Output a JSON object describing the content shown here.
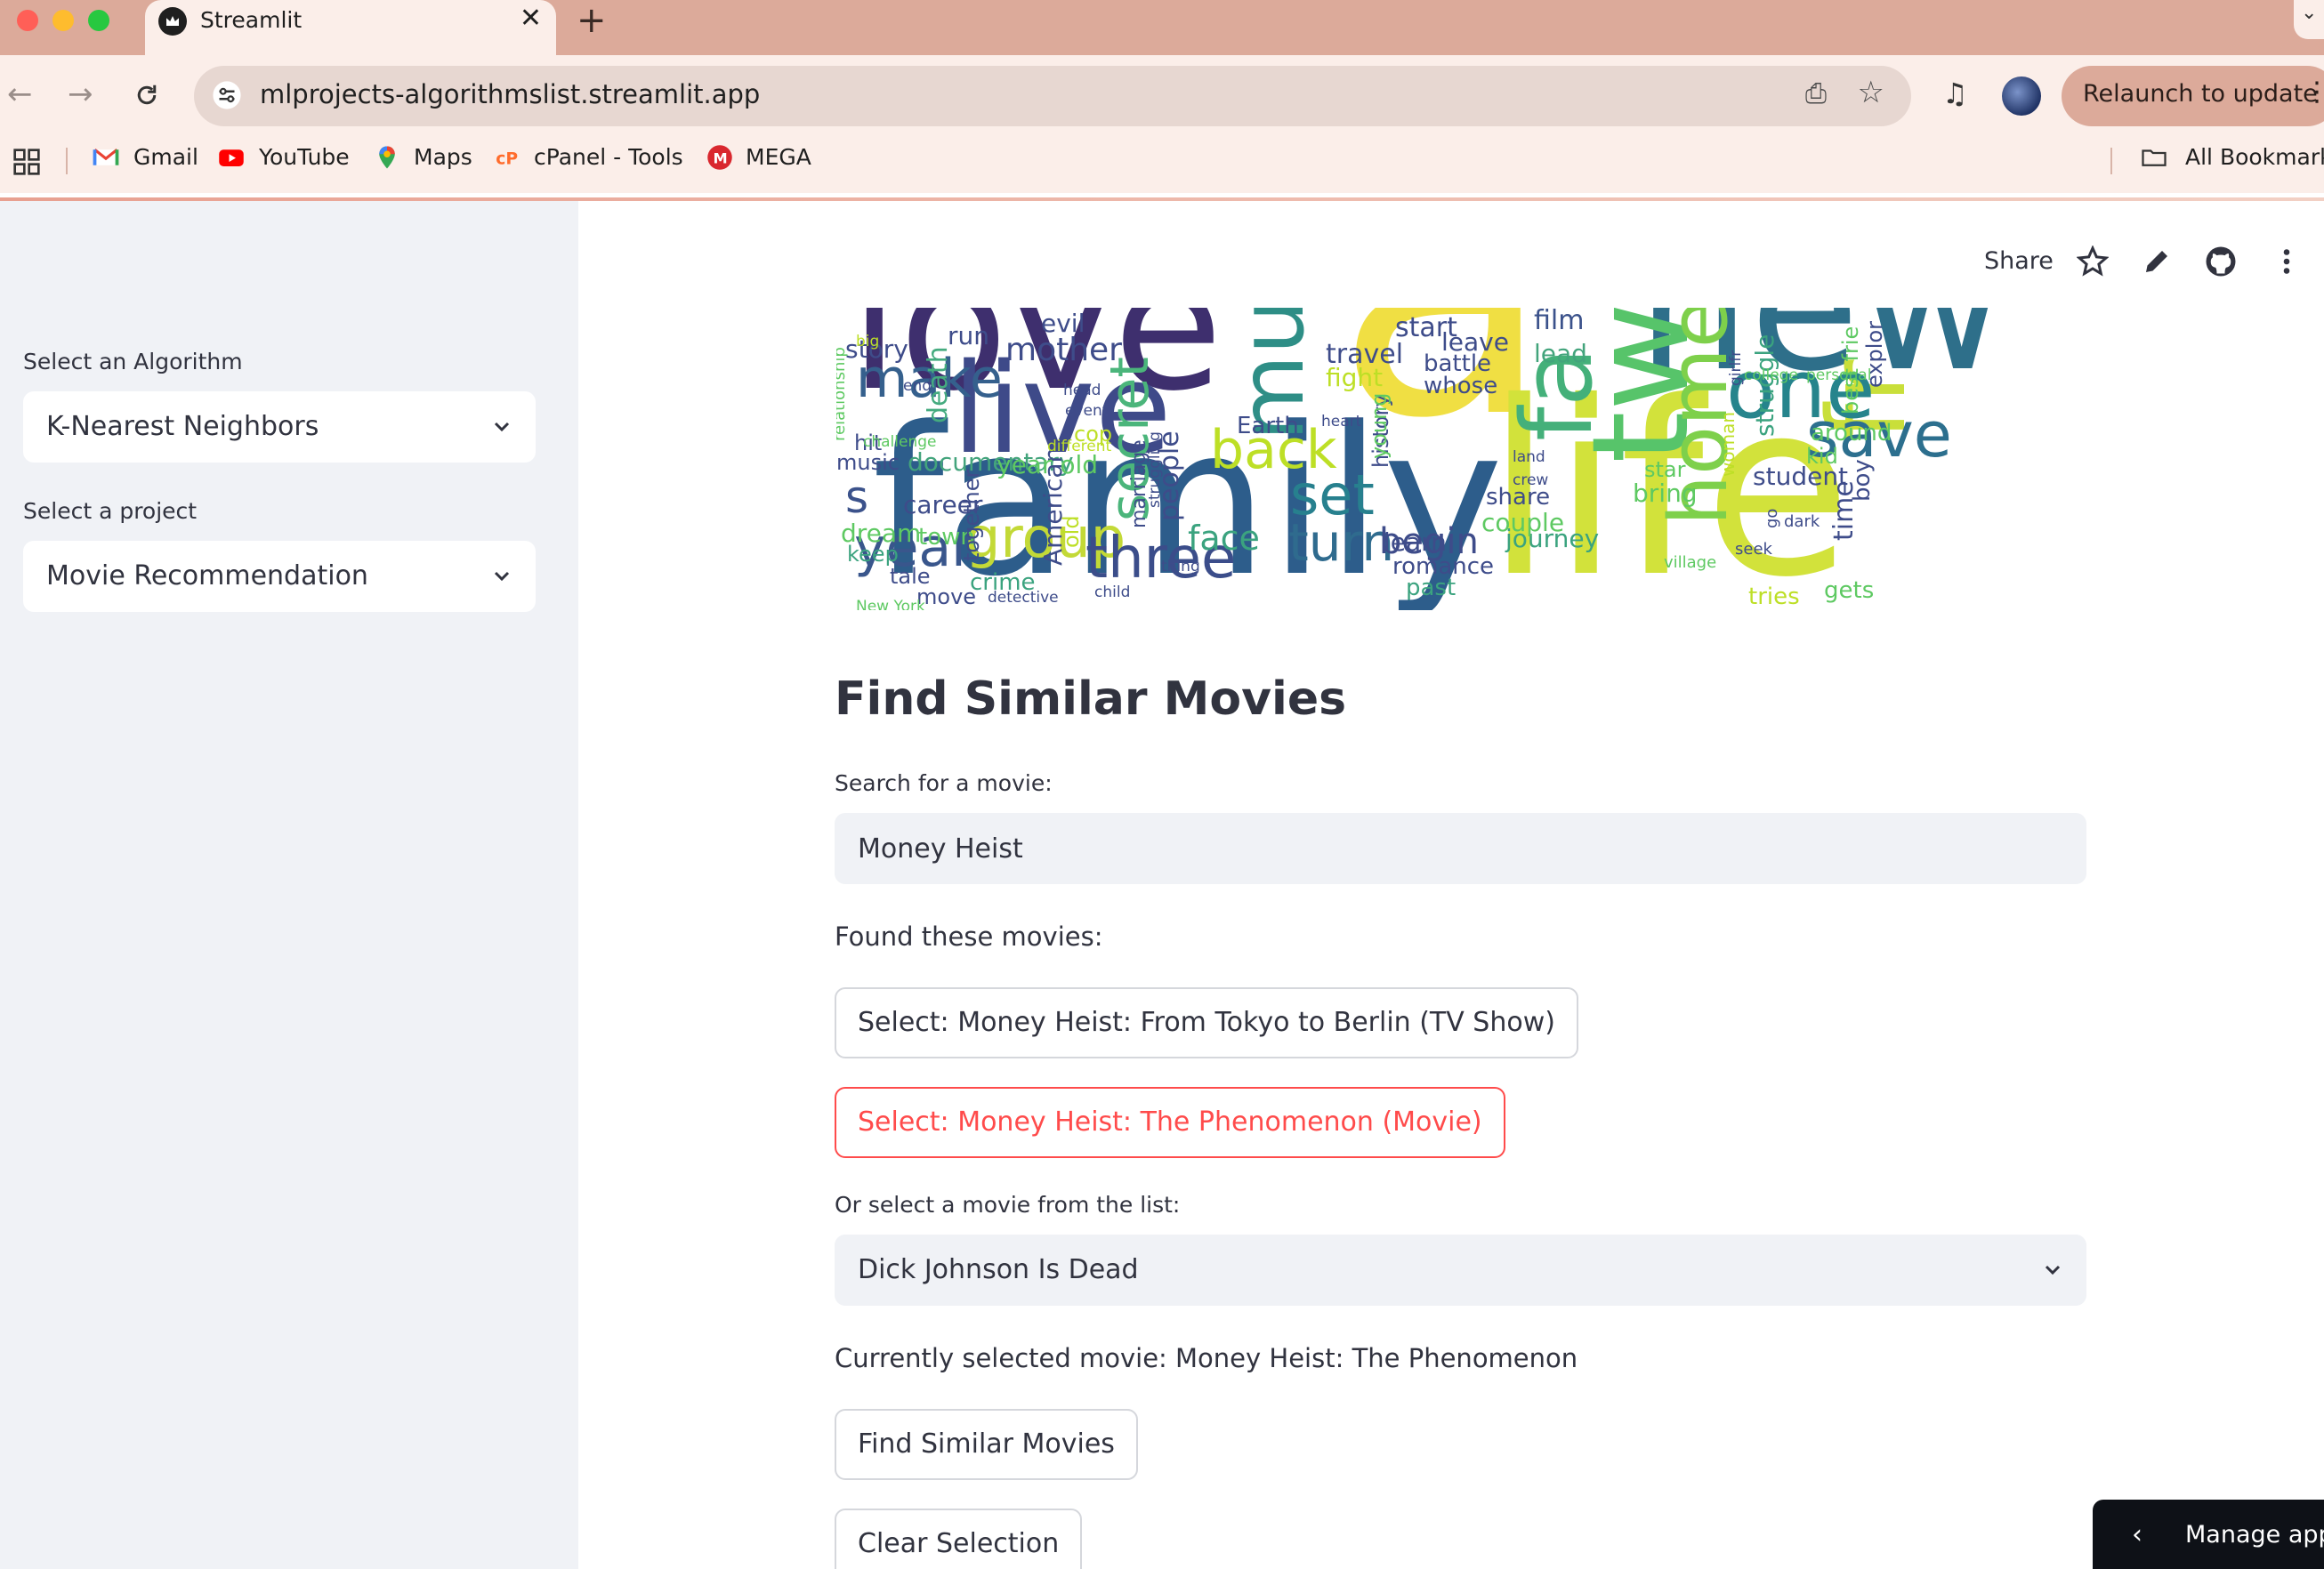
{
  "browser": {
    "tab_title": "Streamlit",
    "tab_close": "✕",
    "new_tab": "+",
    "url": "mlprojects-algorithmslist.streamlit.app",
    "relaunch_label": "Relaunch to update",
    "bookmarks": [
      "Gmail",
      "YouTube",
      "Maps",
      "cPanel - Tools",
      "MEGA"
    ],
    "all_bookmarks": "All Bookmarks"
  },
  "sidebar": {
    "algorithm_label": "Select an Algorithm",
    "algorithm_value": "K-Nearest Neighbors",
    "project_label": "Select a project",
    "project_value": "Movie Recommendation"
  },
  "header": {
    "share": "Share"
  },
  "wordcloud": {
    "words": [
      "love",
      "new",
      "a",
      "live",
      "family",
      "life",
      "two",
      "fa",
      "mus",
      "fr",
      "one",
      "save",
      "home",
      "make",
      "secret",
      "group",
      "three",
      "year",
      "set",
      "turn",
      "back",
      "begin",
      "face",
      "journey",
      "film",
      "lead",
      "start",
      "travel",
      "fight",
      "mother",
      "evil",
      "run",
      "story",
      "death",
      "documentary",
      "career",
      "music",
      "hit",
      "dream",
      "keep",
      "town",
      "crime",
      "move",
      "detective",
      "child",
      "people",
      "history",
      "learn",
      "romance",
      "past",
      "couple",
      "share",
      "bring",
      "star",
      "student",
      "kid",
      "around",
      "time",
      "boy",
      "tries",
      "gets",
      "Earth",
      "leave",
      "battle",
      "whose",
      "heart",
      "young",
      "struggle",
      "explor",
      "best frie",
      "tale",
      "together",
      "American",
      "old",
      "marriage",
      "struggling",
      "thing",
      "cop",
      "different",
      "event",
      "challenge",
      "end",
      "relationship",
      "big",
      "head",
      "land",
      "crew",
      "dark",
      "go",
      "seek",
      "village",
      "college",
      "personal",
      "girlfr",
      "woman",
      "New York",
      "s",
      "year old",
      "live"
    ]
  },
  "main": {
    "title": "Find Similar Movies",
    "search_label": "Search for a movie:",
    "search_value": "Money Heist",
    "found_label": "Found these movies:",
    "results": [
      "Select: Money Heist: From Tokyo to Berlin (TV Show)",
      "Select: Money Heist: The Phenomenon (Movie)"
    ],
    "list_label": "Or select a movie from the list:",
    "list_value": "Dick Johnson Is Dead",
    "currently_selected": "Currently selected movie: Money Heist: The Phenomenon",
    "find_button": "Find Similar Movies",
    "clear_button": "Clear Selection"
  },
  "manage_app": {
    "label": "Manage app"
  },
  "colors": {
    "accent": "#ff4b4b",
    "sidebar_bg": "#f0f2f6",
    "chrome_tab": "#dcaa9a"
  }
}
